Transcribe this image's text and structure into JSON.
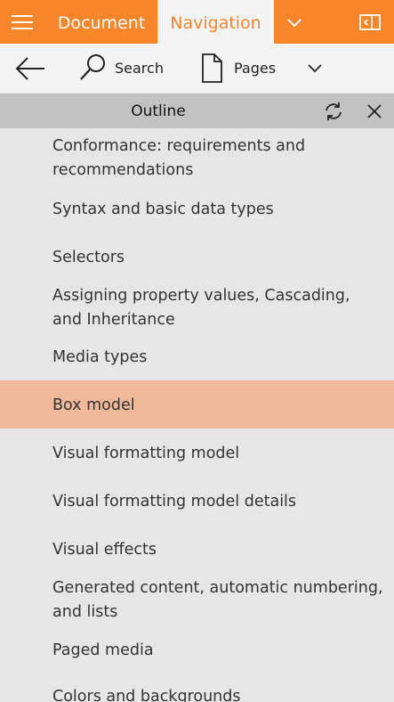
{
  "tabs": {
    "document": "Document",
    "navigation": "Navigation"
  },
  "toolbar": {
    "search_label": "Search",
    "pages_label": "Pages"
  },
  "outline": {
    "title": "Outline",
    "items": [
      {
        "label": "Conformance: requirements and recommendations",
        "selected": false
      },
      {
        "label": "Syntax and basic data types",
        "selected": false
      },
      {
        "label": "Selectors",
        "selected": false
      },
      {
        "label": "Assigning property values, Cascading, and Inheritance",
        "selected": false
      },
      {
        "label": "Media types",
        "selected": false
      },
      {
        "label": "Box model",
        "selected": true
      },
      {
        "label": "Visual formatting model",
        "selected": false
      },
      {
        "label": "Visual formatting model details",
        "selected": false
      },
      {
        "label": "Visual effects",
        "selected": false
      },
      {
        "label": "Generated content, automatic numbering, and lists",
        "selected": false
      },
      {
        "label": "Paged media",
        "selected": false
      },
      {
        "label": "Colors and backgrounds",
        "selected": false
      }
    ]
  },
  "colors": {
    "accent": "#f7862a",
    "selected_row": "#f0b99a",
    "header_bar": "#c2c2c2",
    "list_background": "#e6e6e6"
  },
  "icons": [
    "hamburger-icon",
    "chevron-down-icon",
    "panel-toggle-icon",
    "back-arrow-icon",
    "search-icon",
    "page-icon",
    "refresh-icon",
    "close-icon"
  ]
}
